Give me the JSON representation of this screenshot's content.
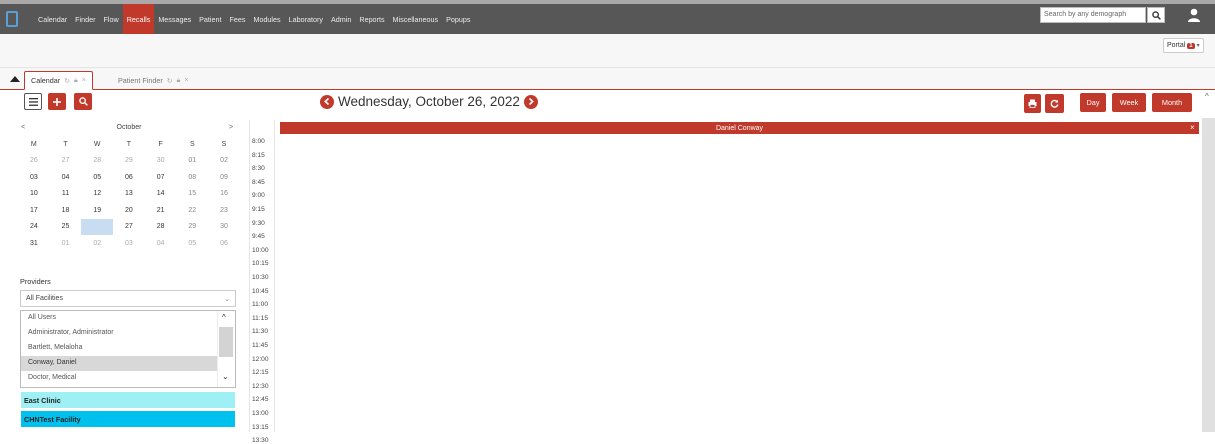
{
  "nav": {
    "items": [
      "Calendar",
      "Finder",
      "Flow",
      "Recalls",
      "Messages",
      "Patient",
      "Fees",
      "Modules",
      "Laboratory",
      "Admin",
      "Reports",
      "Miscellaneous",
      "Popups"
    ],
    "active": "Recalls",
    "search_placeholder": "Search by any demograph"
  },
  "portal": {
    "label": "Portal",
    "badge": "1"
  },
  "tabs": [
    {
      "label": "Calendar",
      "active": true
    },
    {
      "label": "Patient Finder",
      "active": false
    }
  ],
  "toolbar": {
    "date_title": "Wednesday, October 26, 2022",
    "views": [
      "Day",
      "Week",
      "Month"
    ]
  },
  "mini_calendar": {
    "prev": "<",
    "next": ">",
    "month": "October",
    "dow": [
      "M",
      "T",
      "W",
      "T",
      "F",
      "S",
      "S"
    ],
    "weeks": [
      [
        "26",
        "27",
        "28",
        "29",
        "30",
        "01",
        "02"
      ],
      [
        "03",
        "04",
        "05",
        "06",
        "07",
        "08",
        "09"
      ],
      [
        "10",
        "11",
        "12",
        "13",
        "14",
        "15",
        "16"
      ],
      [
        "17",
        "18",
        "19",
        "20",
        "21",
        "22",
        "23"
      ],
      [
        "24",
        "25",
        "26",
        "27",
        "28",
        "29",
        "30"
      ],
      [
        "31",
        "01",
        "02",
        "03",
        "04",
        "05",
        "06"
      ]
    ],
    "today": "26"
  },
  "providers": {
    "label": "Providers",
    "facility_select": "All Facilities",
    "users": [
      "All Users",
      "Administrator, Administrator",
      "Bartlett, Melaloha",
      "Conway, Daniel",
      "Doctor, Medical"
    ],
    "selected_user": "Conway, Daniel",
    "facilities": [
      {
        "name": "East Clinic",
        "color": "#9ff0f5"
      },
      {
        "name": "CHNTest Facility",
        "color": "#00c0ee"
      }
    ]
  },
  "schedule": {
    "provider": "Daniel Conway",
    "times": [
      "8:00",
      "8:15",
      "8:30",
      "8:45",
      "9:00",
      "9:15",
      "9:30",
      "9:45",
      "10:00",
      "10:15",
      "10:30",
      "10:45",
      "11:00",
      "11:15",
      "11:30",
      "11:45",
      "12:00",
      "12:15",
      "12:30",
      "12:45",
      "13:00",
      "13:15",
      "13:30"
    ]
  },
  "colors": {
    "accent": "#c0392b",
    "topbar": "#575757"
  }
}
